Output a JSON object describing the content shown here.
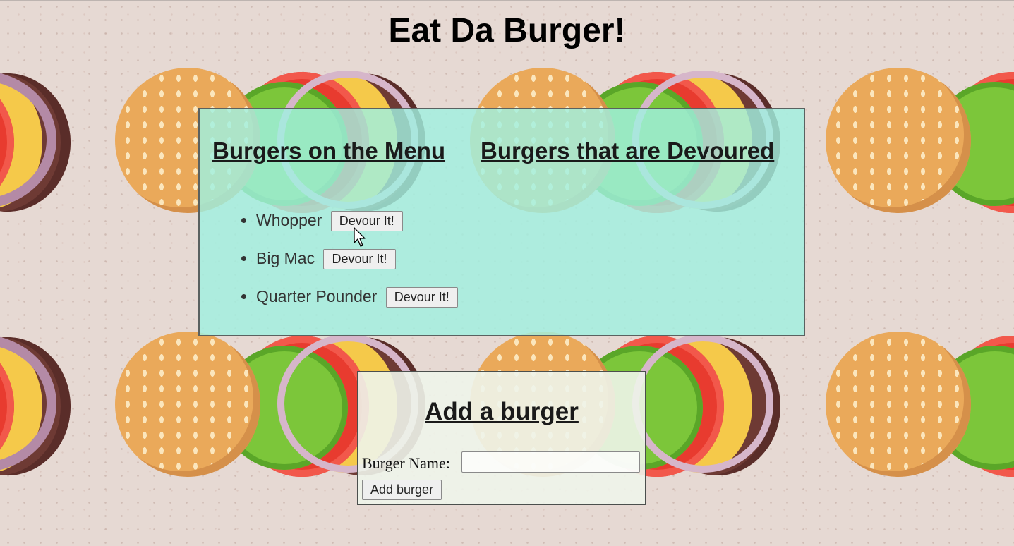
{
  "page": {
    "title": "Eat Da Burger!"
  },
  "menu_panel": {
    "menu_heading": "Burgers on the Menu",
    "devoured_heading": "Burgers that are Devoured",
    "items": [
      {
        "name": "Whopper",
        "button": "Devour It!"
      },
      {
        "name": "Big Mac",
        "button": "Devour It!"
      },
      {
        "name": "Quarter Pounder",
        "button": "Devour It!"
      }
    ]
  },
  "add_panel": {
    "heading": "Add a burger",
    "name_label": "Burger Name:",
    "name_value": "",
    "submit_label": "Add burger"
  },
  "colors": {
    "background": "#e6d9d3",
    "menu_panel_bg": "#a0f0e1",
    "add_panel_bg": "#eef4ea",
    "panel_border": "#5a6160"
  },
  "icons": {
    "cursor": "mouse-pointer-icon"
  }
}
